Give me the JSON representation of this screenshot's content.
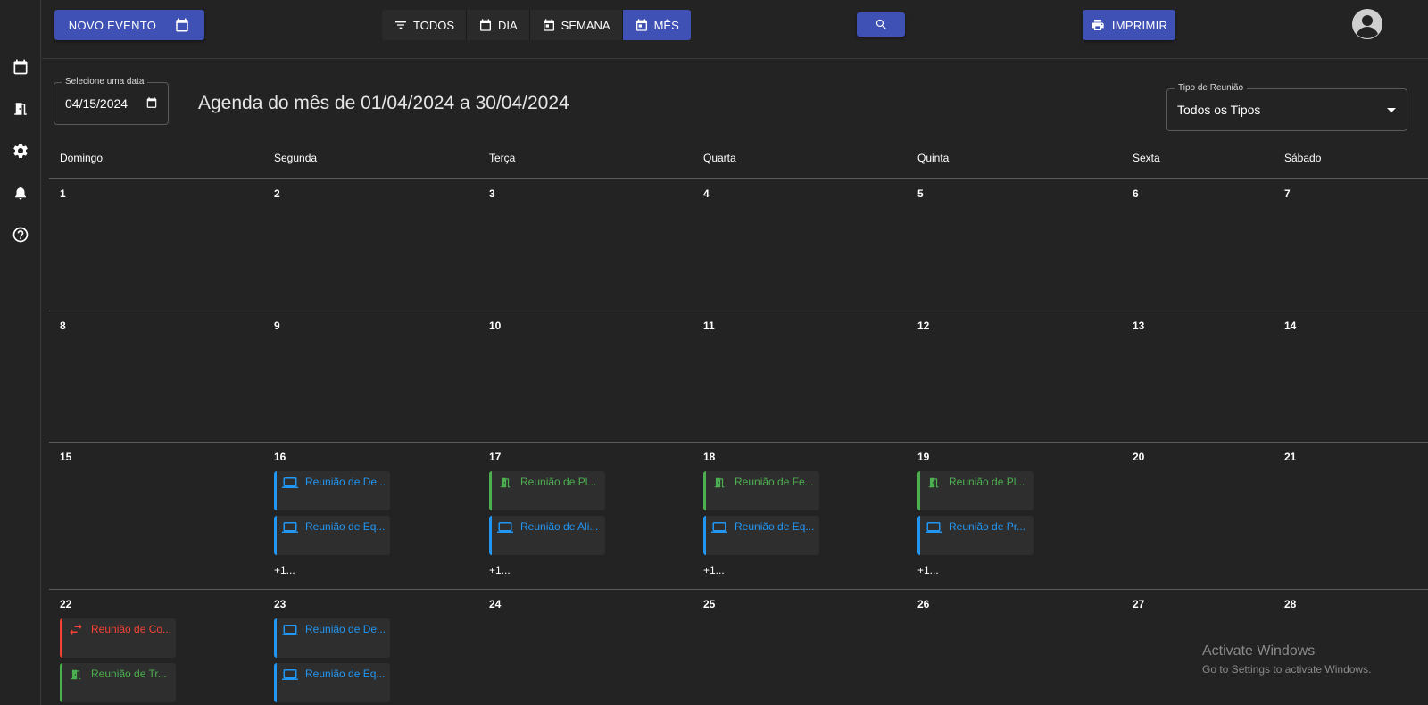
{
  "sidebar": {
    "items": [
      {
        "icon": "calendar-icon"
      },
      {
        "icon": "door-icon"
      },
      {
        "icon": "gear-icon"
      },
      {
        "icon": "bell-icon"
      },
      {
        "icon": "help-icon"
      }
    ]
  },
  "toolbar": {
    "new_event_label": "NOVO EVENTO",
    "filter_all_label": "TODOS",
    "view_day_label": "DIA",
    "view_week_label": "SEMANA",
    "view_month_label": "MÊS",
    "print_label": "IMPRIMIR",
    "active_view": "MÊS"
  },
  "date_picker": {
    "label": "Selecione uma data",
    "value": "04/15/2024"
  },
  "agenda_title": "Agenda do mês de 01/04/2024 a 30/04/2024",
  "meeting_type": {
    "label": "Tipo de Reunião",
    "value": "Todos os Tipos"
  },
  "weekdays": [
    "Domingo",
    "Segunda",
    "Terça",
    "Quarta",
    "Quinta",
    "Sexta",
    "Sábado"
  ],
  "weeks": [
    {
      "days": [
        "1",
        "2",
        "3",
        "4",
        "5",
        "6",
        "7"
      ]
    },
    {
      "days": [
        "8",
        "9",
        "10",
        "11",
        "12",
        "13",
        "14"
      ]
    },
    {
      "days": [
        "15",
        "16",
        "17",
        "18",
        "19",
        "20",
        "21"
      ]
    },
    {
      "days": [
        "22",
        "23",
        "24",
        "25",
        "26",
        "27",
        "28"
      ]
    }
  ],
  "events": {
    "d16": [
      {
        "label": "Reunião de De...",
        "type": "online",
        "color": "#2196f3"
      },
      {
        "label": "Reunião de Eq...",
        "type": "online",
        "color": "#2196f3"
      }
    ],
    "d16_more": "+1...",
    "d17": [
      {
        "label": "Reunião de Pl...",
        "type": "presencial",
        "color": "#4caf50"
      },
      {
        "label": "Reunião de Ali...",
        "type": "online",
        "color": "#2196f3"
      }
    ],
    "d17_more": "+1...",
    "d18": [
      {
        "label": "Reunião de Fe...",
        "type": "presencial",
        "color": "#4caf50"
      },
      {
        "label": "Reunião de Eq...",
        "type": "online",
        "color": "#2196f3"
      }
    ],
    "d18_more": "+1...",
    "d19": [
      {
        "label": "Reunião de Pl...",
        "type": "presencial",
        "color": "#4caf50"
      },
      {
        "label": "Reunião de Pr...",
        "type": "online",
        "color": "#2196f3"
      }
    ],
    "d19_more": "+1...",
    "d22": [
      {
        "label": "Reunião de Co...",
        "type": "hibrida",
        "color": "#f44336"
      },
      {
        "label": "Reunião de Tr...",
        "type": "presencial",
        "color": "#4caf50"
      }
    ],
    "d23": [
      {
        "label": "Reunião de De...",
        "type": "online",
        "color": "#2196f3"
      },
      {
        "label": "Reunião de Eq...",
        "type": "online",
        "color": "#2196f3"
      }
    ]
  },
  "watermark": {
    "line1": "Activate Windows",
    "line2": "Go to Settings to activate Windows."
  },
  "colors": {
    "primary": "#3f51b5",
    "online": "#2196f3",
    "presencial": "#4caf50",
    "hibrida": "#f44336",
    "background": "#232323"
  }
}
